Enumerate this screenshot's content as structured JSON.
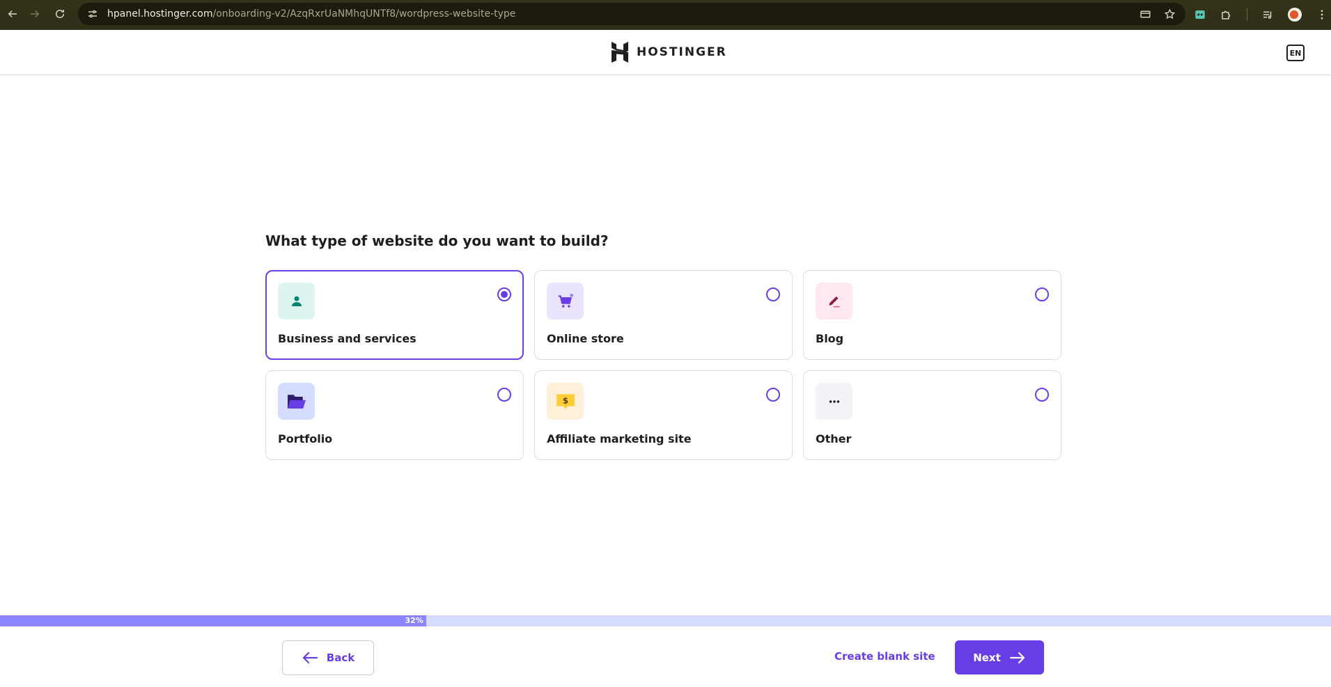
{
  "browser": {
    "url_host": "hpanel.hostinger.com",
    "url_path": "/onboarding-v2/AzqRxrUaNMhqUNTf8/wordpress-website-type"
  },
  "header": {
    "logo_text": "HOSTINGER",
    "language": "EN"
  },
  "main": {
    "question": "What type of website do you want to build?",
    "options": [
      {
        "label": "Business and services",
        "icon": "person-icon",
        "icon_bg": "#def4f0",
        "icon_color": "#00866e",
        "selected": true
      },
      {
        "label": "Online store",
        "icon": "cart-icon",
        "icon_bg": "#ebe4ff",
        "icon_color": "#673de6",
        "selected": false
      },
      {
        "label": "Blog",
        "icon": "pen-icon",
        "icon_bg": "#ffe8ef",
        "icon_color": "#8c1742",
        "selected": false
      },
      {
        "label": "Portfolio",
        "icon": "folder-icon",
        "icon_bg": "#d5dcff",
        "icon_color": "#2f1c6a",
        "selected": false
      },
      {
        "label": "Affiliate marketing site",
        "icon": "dollar-tag-icon",
        "icon_bg": "#fff0d9",
        "icon_color": "#ffcd35",
        "selected": false
      },
      {
        "label": "Other",
        "icon": "more-icon",
        "icon_bg": "#f2f3f6",
        "icon_color": "#1d1e20",
        "selected": false
      }
    ]
  },
  "progress": {
    "percent": 32,
    "label": "32%"
  },
  "footer": {
    "back_label": "Back",
    "blank_site_label": "Create blank site",
    "next_label": "Next"
  },
  "colors": {
    "accent": "#673de6",
    "progress_fill": "#8c85ff",
    "progress_track": "#d5dcff"
  }
}
